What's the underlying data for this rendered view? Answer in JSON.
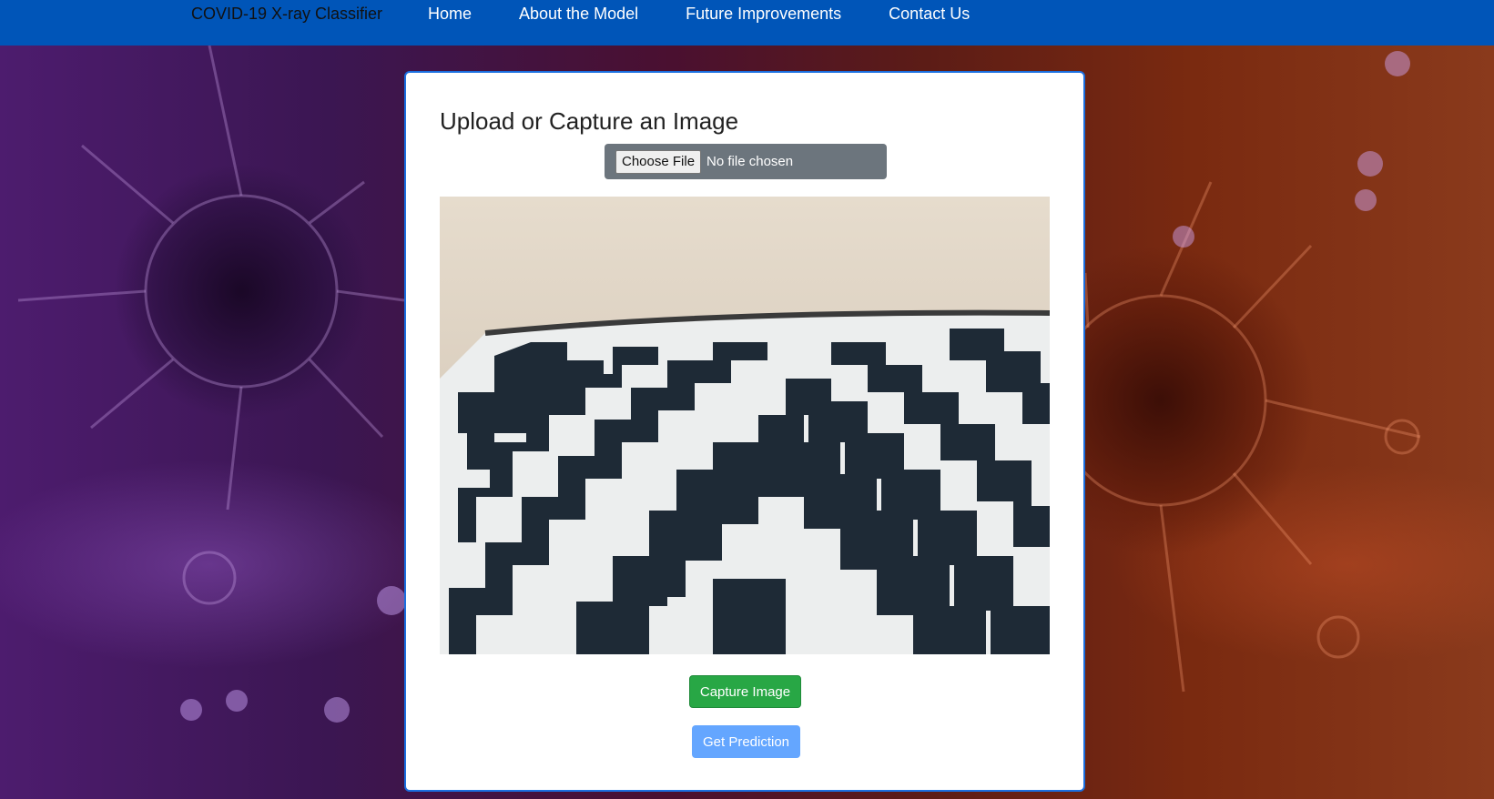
{
  "navbar": {
    "brand": "COVID-19 X-ray Classifier",
    "links": [
      "Home",
      "About the Model",
      "Future Improvements",
      "Contact Us"
    ],
    "background_color": "#0055b8"
  },
  "card": {
    "title": "Upload or Capture an Image",
    "file_input": {
      "button_label": "Choose File",
      "status": "No file chosen"
    },
    "camera_feed": {
      "icon": "webcam-feed"
    },
    "buttons": {
      "capture_label": "Capture Image",
      "predict_label": "Get Prediction"
    }
  },
  "colors": {
    "card_border": "#1a6fe0",
    "capture_button": "#28a745",
    "predict_button": "#64a6ff",
    "file_box": "#6c757d"
  }
}
